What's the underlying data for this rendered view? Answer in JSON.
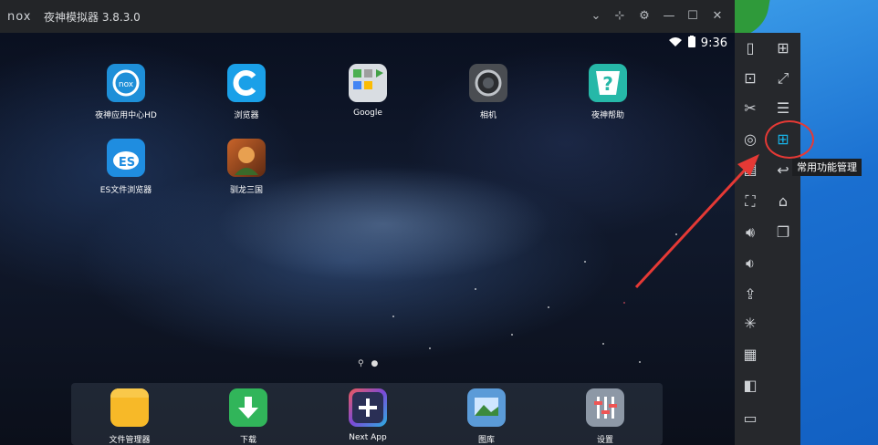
{
  "window": {
    "title": "夜神模拟器 3.8.3.0",
    "logo_text": "nox"
  },
  "status_bar": {
    "time": "9:36"
  },
  "apps": [
    {
      "label": "夜神应用中心HD",
      "icon": "nox-app-center-icon",
      "color": "#1e8fd8"
    },
    {
      "label": "浏览器",
      "icon": "browser-icon",
      "color": "#1aa0e8"
    },
    {
      "label": "Google",
      "icon": "google-folder-icon",
      "color": "#d9dde2"
    },
    {
      "label": "相机",
      "icon": "camera-icon",
      "color": "#4a4d52"
    },
    {
      "label": "夜神帮助",
      "icon": "nox-help-icon",
      "color": "#26b8a8"
    },
    {
      "label": "ES文件浏览器",
      "icon": "es-file-explorer-icon",
      "color": "#1f8de0"
    },
    {
      "label": "驯龙三国",
      "icon": "game-icon",
      "color": "#a04a22"
    }
  ],
  "dock": [
    {
      "label": "文件管理器",
      "icon": "folder-icon",
      "color": "#f7b928"
    },
    {
      "label": "下载",
      "icon": "download-icon",
      "color": "#31b55a"
    },
    {
      "label": "Next App",
      "icon": "next-app-icon",
      "color": "#2a2f55"
    },
    {
      "label": "图库",
      "icon": "gallery-icon",
      "color": "#5b9bd8"
    },
    {
      "label": "设置",
      "icon": "settings-icon",
      "color": "#8d98a6"
    }
  ],
  "sidebar": {
    "tooltip": "常用功能管理",
    "left_icons": [
      "shake-icon",
      "robot-icon",
      "scissors-icon",
      "location-icon",
      "keyboard-icon",
      "fullscreen-icon",
      "volume-up-icon",
      "volume-down-icon",
      "apk-icon",
      "loading-icon",
      "macro-icon",
      "video-icon",
      "multi-instance-icon"
    ],
    "right_icons": [
      "gamepad-icon",
      "resize-icon",
      "menu-icon",
      "feature-manage-icon",
      "back-icon",
      "home-icon",
      "recents-icon"
    ]
  },
  "colors": {
    "highlight": "#e53935",
    "accent": "#18b4e8"
  }
}
